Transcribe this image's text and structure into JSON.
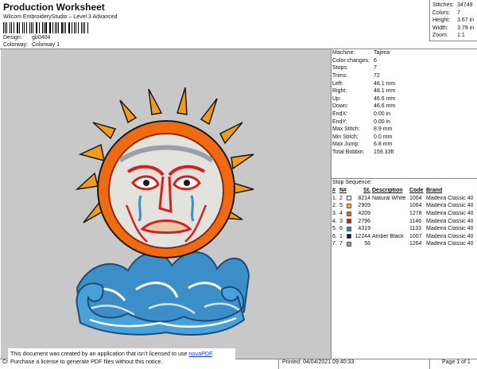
{
  "header": {
    "title": "Production Worksheet",
    "software": "Wilcom EmbroideryStudio – Level 3 Advanced",
    "design_label": "Design:",
    "design_value": "gb0404",
    "colorway_label": "Colorway:",
    "colorway_value": "Colorway 1"
  },
  "stats": [
    {
      "label": "Stitches:",
      "value": "34749"
    },
    {
      "label": "Colors:",
      "value": "7"
    },
    {
      "label": "Height:",
      "value": "3.67 in"
    },
    {
      "label": "Width:",
      "value": "3.79 in"
    },
    {
      "label": "Zoom:",
      "value": "1:1"
    }
  ],
  "info": [
    {
      "label": "Machine:",
      "value": "Tajima"
    },
    {
      "label": "Color changes:",
      "value": "6"
    },
    {
      "label": "Stops:",
      "value": "7"
    },
    {
      "label": "Trims:",
      "value": "72"
    },
    {
      "label": "Left:",
      "value": "48.1 mm"
    },
    {
      "label": "Right:",
      "value": "48.1 mm"
    },
    {
      "label": "Up:",
      "value": "46.6 mm"
    },
    {
      "label": "Down:",
      "value": "46.6 mm"
    },
    {
      "label": "EndX:",
      "value": "0.00 in"
    },
    {
      "label": "EndY:",
      "value": "0.00 in"
    },
    {
      "label": "Max Stitch:",
      "value": "8.9 mm"
    },
    {
      "label": "Min Stitch:",
      "value": "0.0 mm"
    },
    {
      "label": "Max Jump:",
      "value": "6.8 mm"
    },
    {
      "label": "Total Bobbin:",
      "value": "159.33ft"
    }
  ],
  "stop_sequence": {
    "title": "Stop Sequence:",
    "headers": {
      "num": "#",
      "n": "N#",
      "st": "St.",
      "desc": "Description",
      "code": "Code",
      "brand": "Brand"
    },
    "rows": [
      {
        "num": "1.",
        "n": "2",
        "color": "#f2f2f2",
        "st": "8214",
        "desc": "Natural White",
        "code": "1004",
        "brand": "Madeira Classic 40"
      },
      {
        "num": "2.",
        "n": "5",
        "color": "#f7b800",
        "st": "2909",
        "desc": "",
        "code": "1064",
        "brand": "Madeira Classic 40"
      },
      {
        "num": "3.",
        "n": "4",
        "color": "#f06a00",
        "st": "4209",
        "desc": "",
        "code": "1278",
        "brand": "Madeira Classic 40"
      },
      {
        "num": "4.",
        "n": "3",
        "color": "#d52020",
        "st": "2796",
        "desc": "",
        "code": "1146",
        "brand": "Madeira Classic 40"
      },
      {
        "num": "5.",
        "n": "6",
        "color": "#3f86c8",
        "st": "4319",
        "desc": "",
        "code": "1133",
        "brand": "Madeira Classic 40"
      },
      {
        "num": "6.",
        "n": "1",
        "color": "#1a1a1a",
        "st": "12244",
        "desc": "Amber Black",
        "code": "1007",
        "brand": "Madeira Classic 40"
      },
      {
        "num": "7.",
        "n": "7",
        "color": "#9a9a9a",
        "st": "56",
        "desc": "",
        "code": "1264",
        "brand": "Madeira Classic 40"
      }
    ]
  },
  "footer": {
    "notice_line1": "This document was created by an application that isn’t licensed to use ",
    "notice_link": "novaPDF",
    "notice_line1_end": ".",
    "notice_line2": "Purchase a license to generate PDF files without this notice.",
    "cr": "Cr",
    "printed": "Printed: 04/04/2021 09:40:33",
    "page": "Page 1 of 1"
  }
}
